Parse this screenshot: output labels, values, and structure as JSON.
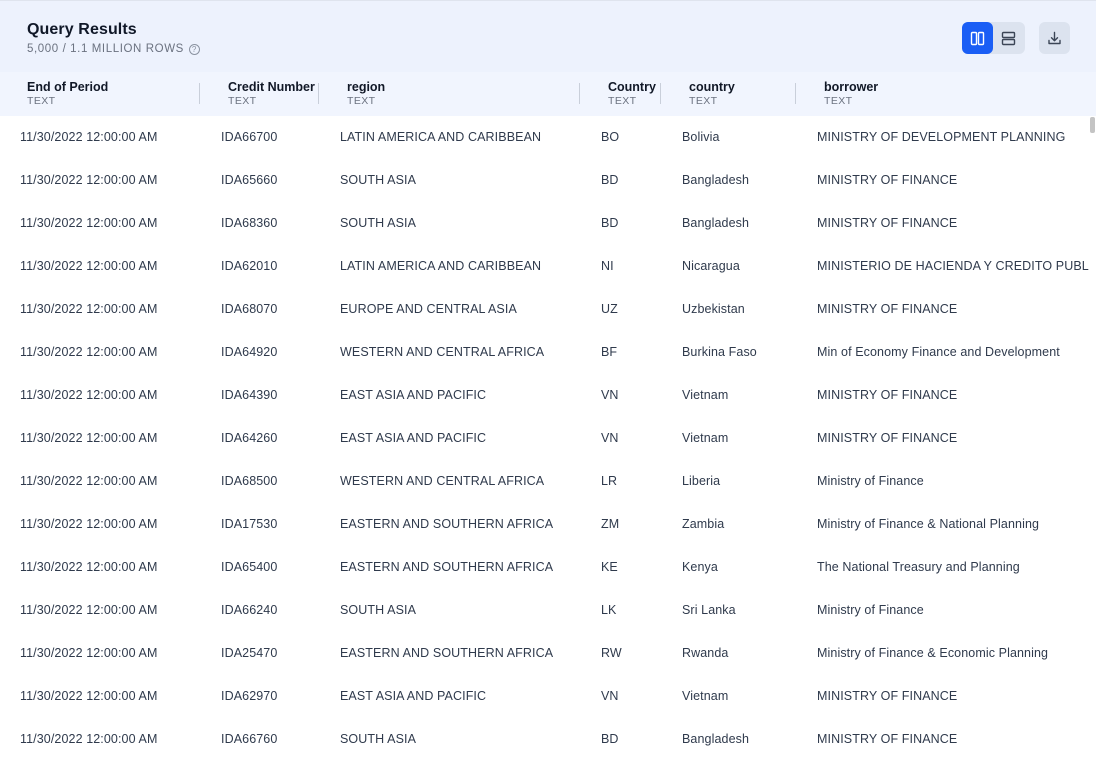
{
  "header": {
    "title": "Query Results",
    "subtitle": "5,000 / 1.1 MILLION ROWS",
    "help_glyph": "?"
  },
  "toolbar": {
    "column_view_icon": "columns-icon",
    "row_view_icon": "rows-icon",
    "download_icon": "download-icon",
    "accent_color": "#1a5ef5"
  },
  "columns": [
    {
      "name": "End of Period",
      "type": "TEXT"
    },
    {
      "name": "Credit Number",
      "type": "TEXT"
    },
    {
      "name": "region",
      "type": "TEXT"
    },
    {
      "name": "Country",
      "type": "TEXT"
    },
    {
      "name": "country",
      "type": "TEXT"
    },
    {
      "name": "borrower",
      "type": "TEXT"
    }
  ],
  "rows": [
    [
      "11/30/2022 12:00:00 AM",
      "IDA66700",
      "LATIN AMERICA AND CARIBBEAN",
      "BO",
      "Bolivia",
      "MINISTRY OF DEVELOPMENT PLANNING"
    ],
    [
      "11/30/2022 12:00:00 AM",
      "IDA65660",
      "SOUTH ASIA",
      "BD",
      "Bangladesh",
      "MINISTRY OF FINANCE"
    ],
    [
      "11/30/2022 12:00:00 AM",
      "IDA68360",
      "SOUTH ASIA",
      "BD",
      "Bangladesh",
      "MINISTRY OF FINANCE"
    ],
    [
      "11/30/2022 12:00:00 AM",
      "IDA62010",
      "LATIN AMERICA AND CARIBBEAN",
      "NI",
      "Nicaragua",
      "MINISTERIO DE HACIENDA Y CREDITO PUBLICO"
    ],
    [
      "11/30/2022 12:00:00 AM",
      "IDA68070",
      "EUROPE AND CENTRAL ASIA",
      "UZ",
      "Uzbekistan",
      "MINISTRY OF FINANCE"
    ],
    [
      "11/30/2022 12:00:00 AM",
      "IDA64920",
      "WESTERN AND CENTRAL AFRICA",
      "BF",
      "Burkina Faso",
      "Min of Economy Finance and Development"
    ],
    [
      "11/30/2022 12:00:00 AM",
      "IDA64390",
      "EAST ASIA AND PACIFIC",
      "VN",
      "Vietnam",
      "MINISTRY OF FINANCE"
    ],
    [
      "11/30/2022 12:00:00 AM",
      "IDA64260",
      "EAST ASIA AND PACIFIC",
      "VN",
      "Vietnam",
      "MINISTRY OF FINANCE"
    ],
    [
      "11/30/2022 12:00:00 AM",
      "IDA68500",
      "WESTERN AND CENTRAL AFRICA",
      "LR",
      "Liberia",
      "Ministry of Finance"
    ],
    [
      "11/30/2022 12:00:00 AM",
      "IDA17530",
      "EASTERN AND SOUTHERN AFRICA",
      "ZM",
      "Zambia",
      "Ministry of Finance & National Planning"
    ],
    [
      "11/30/2022 12:00:00 AM",
      "IDA65400",
      "EASTERN AND SOUTHERN AFRICA",
      "KE",
      "Kenya",
      "The National Treasury and Planning"
    ],
    [
      "11/30/2022 12:00:00 AM",
      "IDA66240",
      "SOUTH ASIA",
      "LK",
      "Sri Lanka",
      "Ministry of Finance"
    ],
    [
      "11/30/2022 12:00:00 AM",
      "IDA25470",
      "EASTERN AND SOUTHERN AFRICA",
      "RW",
      "Rwanda",
      "Ministry of Finance & Economic Planning"
    ],
    [
      "11/30/2022 12:00:00 AM",
      "IDA62970",
      "EAST ASIA AND PACIFIC",
      "VN",
      "Vietnam",
      "MINISTRY OF FINANCE"
    ],
    [
      "11/30/2022 12:00:00 AM",
      "IDA66760",
      "SOUTH ASIA",
      "BD",
      "Bangladesh",
      "MINISTRY OF FINANCE"
    ]
  ]
}
